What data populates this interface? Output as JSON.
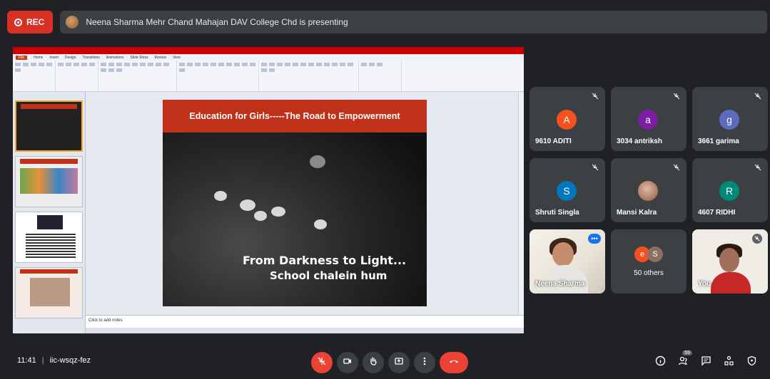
{
  "topbar": {
    "rec_label": "REC",
    "presenting_text": "Neena Sharma Mehr Chand Mahajan DAV College Chd is presenting"
  },
  "ppt": {
    "tabs": [
      "File",
      "Home",
      "Insert",
      "Design",
      "Transitions",
      "Animations",
      "Slide Show",
      "Review",
      "View"
    ],
    "notes_placeholder": "Click to add notes"
  },
  "slide": {
    "header": "Education for Girls-----The Road to Empowerment",
    "line1": "From Darkness to Light...",
    "line2": "School chalein hum"
  },
  "participants": [
    {
      "name": "9610 ADITI",
      "initial": "A",
      "color": "#f4511e"
    },
    {
      "name": "3034 antriksh",
      "initial": "a",
      "color": "#7b1fa2"
    },
    {
      "name": "3661 garima",
      "initial": "g",
      "color": "#5c6bc0"
    },
    {
      "name": "Shruti Singla",
      "initial": "S",
      "color": "#0277bd"
    },
    {
      "name": "Mansi Kalra",
      "initial": "",
      "color": "#8d6e63"
    },
    {
      "name": "4607 RIDHI",
      "initial": "R",
      "color": "#00897b"
    }
  ],
  "video_tiles": {
    "presenter_name": "Neena Sharma",
    "others_label": "50 others",
    "others_initials": [
      "e",
      "S"
    ],
    "you_label": "You"
  },
  "bottombar": {
    "time": "11:41",
    "meeting_code": "iic-wsqz-fez",
    "participants_count": "59"
  },
  "colors": {
    "accent_red": "#ea4335",
    "slide_red": "#c0311a",
    "active_blue": "#8ab4f8"
  }
}
